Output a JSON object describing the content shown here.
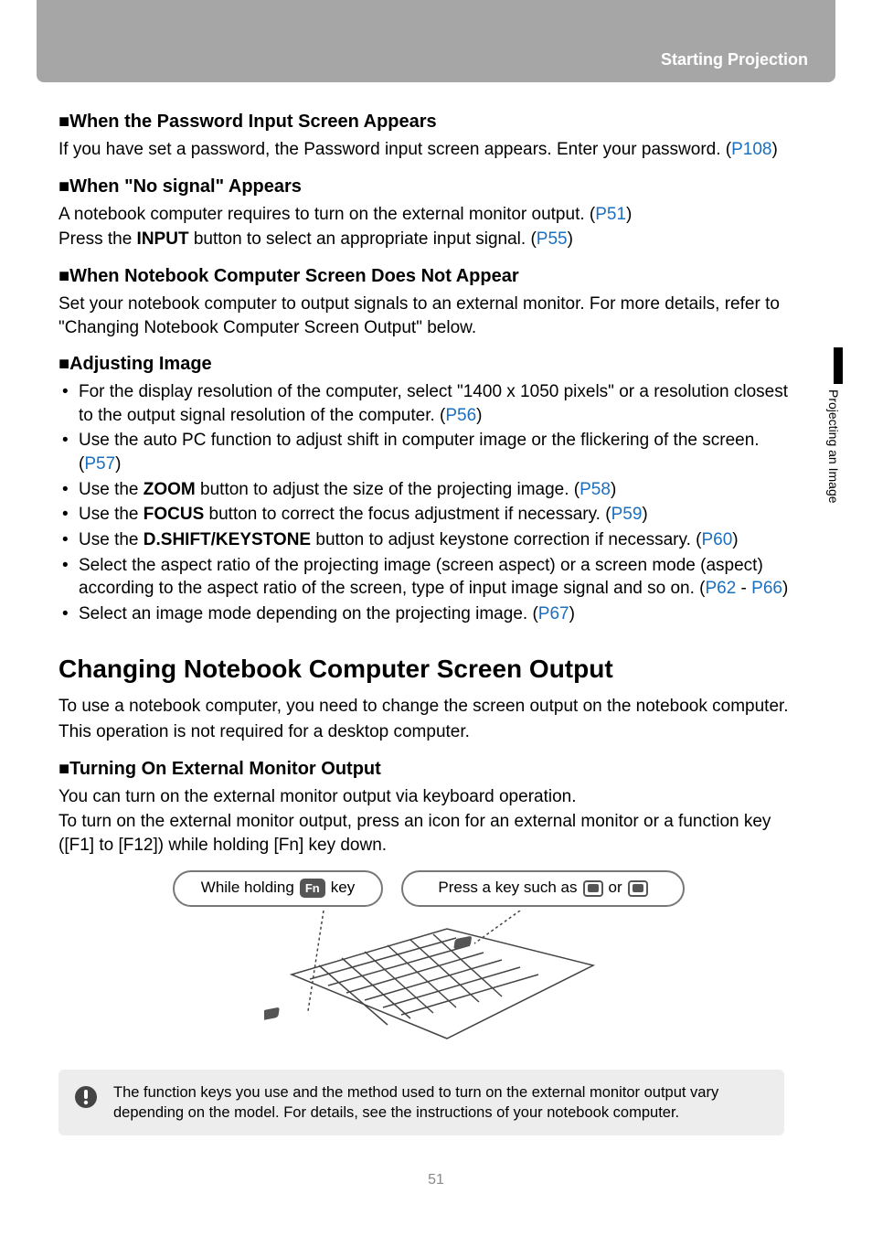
{
  "header": {
    "title": "Starting Projection"
  },
  "sideTab": {
    "label": "Projecting an Image"
  },
  "s1": {
    "heading": "When the Password Input Screen Appears",
    "text": "If you have set a password, the Password input screen appears. Enter your password. (",
    "link": "P108",
    "tail": ")"
  },
  "s2": {
    "heading": "When \"No signal\" Appears",
    "line1a": "A notebook computer requires to turn on the external monitor output. (",
    "line1link": "P51",
    "line1b": ")",
    "line2a": "Press the ",
    "line2bold": "INPUT",
    "line2b": " button to select an appropriate input signal. (",
    "line2link": "P55",
    "line2c": ")"
  },
  "s3": {
    "heading": "When Notebook Computer Screen Does Not Appear",
    "text": "Set your notebook computer to output signals to an external monitor. For more details, refer to \"Changing Notebook Computer Screen Output\" below."
  },
  "s4": {
    "heading": "Adjusting Image",
    "b1a": "For the display resolution of the computer, select \"1400 x 1050 pixels\" or a resolution closest to the output signal resolution of the computer. (",
    "b1link": "P56",
    "b1b": ")",
    "b2a": "Use the auto PC function to adjust shift in computer image or the flickering of the screen. (",
    "b2link": "P57",
    "b2b": ")",
    "b3a": "Use the ",
    "b3bold": "ZOOM",
    "b3b": " button to adjust the size of the projecting image. (",
    "b3link": "P58",
    "b3c": ")",
    "b4a": "Use the ",
    "b4bold": "FOCUS",
    "b4b": " button to correct the focus adjustment if necessary. (",
    "b4link": "P59",
    "b4c": ")",
    "b5a": "Use the ",
    "b5bold": "D.SHIFT/KEYSTONE",
    "b5b": " button to adjust keystone correction if necessary. (",
    "b5link": "P60",
    "b5c": ")",
    "b6a": "Select the aspect ratio of the projecting image (screen aspect) or a screen mode (aspect) according to the aspect ratio of the screen, type of input image signal and so on. (",
    "b6link1": "P62",
    "b6mid": " - ",
    "b6link2": "P66",
    "b6b": ")",
    "b7a": "Select an image mode depending on the projecting image. (",
    "b7link": "P67",
    "b7b": ")"
  },
  "h2": "Changing Notebook Computer Screen Output",
  "s5": {
    "p1": "To use a notebook computer, you need to change the screen output on the notebook computer.",
    "p2": "This operation is not required for a desktop computer."
  },
  "s6": {
    "heading": "Turning On External Monitor Output",
    "p1": "You can turn on the external monitor output via keyboard operation.",
    "p2": "To turn on the external monitor output, press an icon for an external monitor or a function key ([F1] to [F12]) while holding [Fn] key down."
  },
  "diagram": {
    "leftPre": "While holding",
    "leftKey": "Fn",
    "leftPost": "key",
    "rightPre": "Press a key such as",
    "rightMid": "or"
  },
  "note": {
    "text": "The function keys you use and the method used to turn on the external monitor output vary depending on the model. For details, see the instructions of your notebook computer."
  },
  "pageNumber": "51"
}
